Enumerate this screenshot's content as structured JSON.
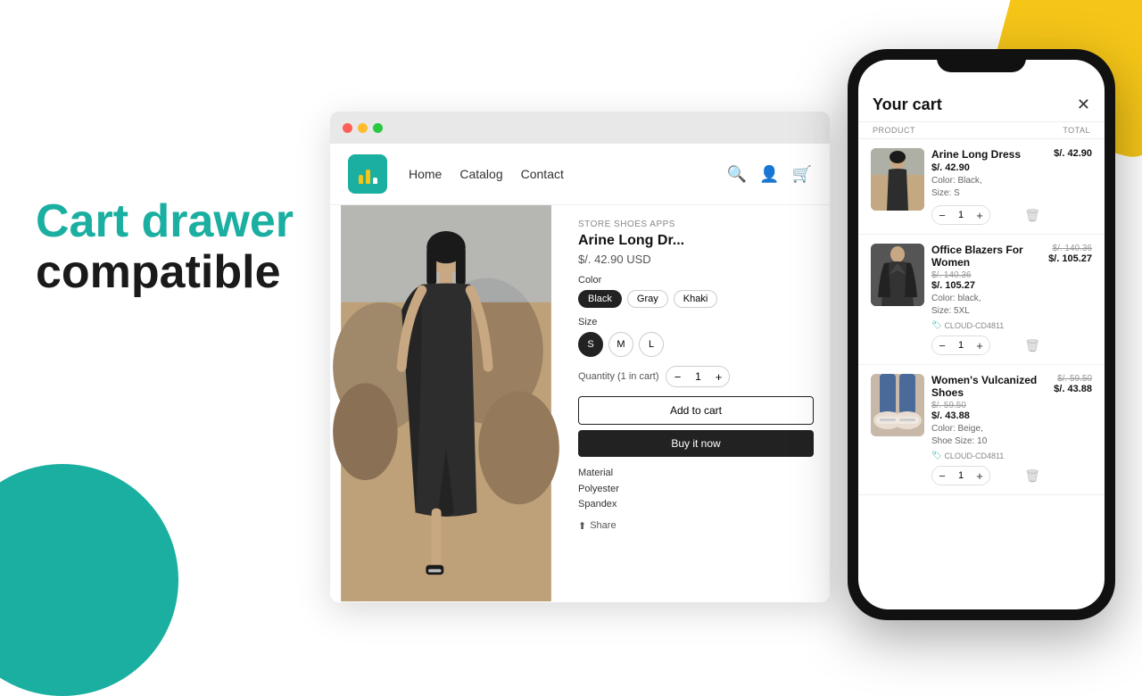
{
  "page": {
    "background_color": "#ffffff"
  },
  "hero": {
    "line1": "Cart drawer",
    "line2": "compatible"
  },
  "browser": {
    "dots": [
      "red",
      "yellow",
      "green"
    ],
    "nav": {
      "links": [
        "Home",
        "Catalog",
        "Contact"
      ]
    },
    "product": {
      "store_tag": "STORE SHOES APPS",
      "name": "Arine Long Dr...",
      "price": "$/.  42.90 USD",
      "color_label": "Color",
      "colors": [
        "Black",
        "Gray",
        "Khaki"
      ],
      "size_label": "Size",
      "sizes": [
        "S",
        "M",
        "L"
      ],
      "qty_label": "Quantity (1 in cart)",
      "qty": "1",
      "add_to_cart": "Add to cart",
      "buy_now": "Buy it now",
      "material_label": "Material",
      "materials": [
        "Polyester",
        "Spandex"
      ],
      "share_label": "Share"
    }
  },
  "cart": {
    "title": "Your cart",
    "col_product": "PRODUCT",
    "col_total": "TOTAL",
    "items": [
      {
        "name": "Arine Long Dress",
        "price": "$/.  42.90",
        "orig_price": null,
        "total": "$/.  42.90",
        "color": "Color: Black,",
        "size": "Size: S",
        "qty": "1",
        "img_class": "cart-item-img-1"
      },
      {
        "name": "Office Blazers For Women",
        "price": "$/.  105.27",
        "orig_price": "$/.  140.36",
        "total": "$/.  105.27",
        "total_orig": "$/.  140.36",
        "color": "Color: black,",
        "size": "Size: 5XL",
        "tag": "CLOUD-CD4811",
        "qty": "1",
        "img_class": "cart-item-img-2"
      },
      {
        "name": "Women's Vulcanized Shoes",
        "price": "$/.  43.88",
        "orig_price": "$/.  59.50",
        "total": "$/.  43.88",
        "total_orig": "$/.  59.50",
        "color": "Color: Beige,",
        "size": "Shoe Size: 10",
        "tag": "CLOUD-CD4811",
        "qty": "1",
        "img_class": "cart-item-img-3"
      }
    ]
  }
}
